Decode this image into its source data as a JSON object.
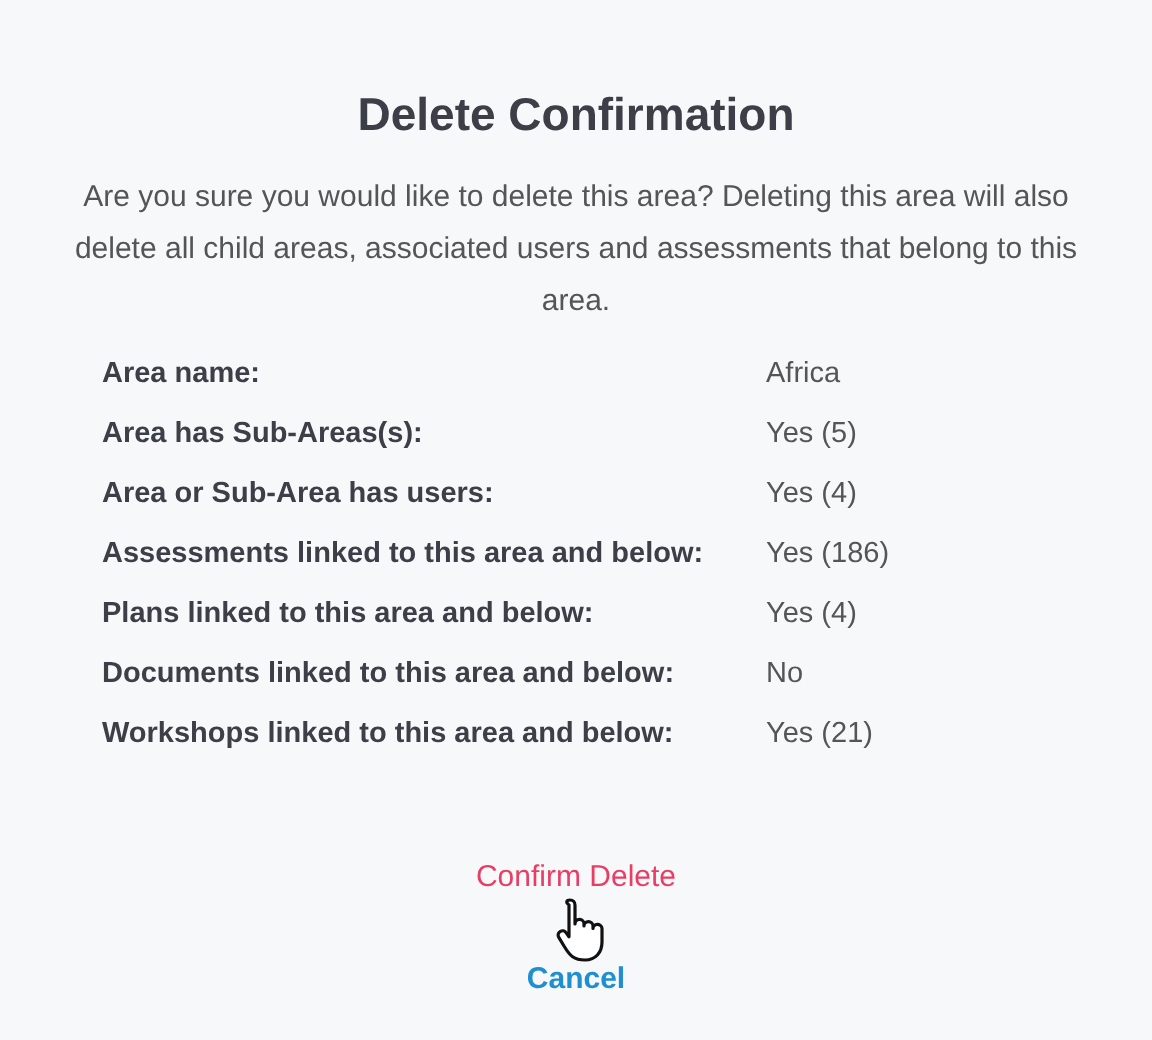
{
  "dialog": {
    "title": "Delete Confirmation",
    "message": "Are you sure you would like to delete this area? Deleting this area will also delete all child areas, associated users and assessments that belong to this area.",
    "details": [
      {
        "label": "Area name:",
        "value": "Africa"
      },
      {
        "label": "Area has Sub-Areas(s):",
        "value": "Yes (5)"
      },
      {
        "label": "Area or Sub-Area has users:",
        "value": "Yes (4)"
      },
      {
        "label": "Assessments linked to this area and below:",
        "value": "Yes (186)"
      },
      {
        "label": "Plans linked to this area and below:",
        "value": "Yes (4)"
      },
      {
        "label": "Documents linked to this area and below:",
        "value": "No"
      },
      {
        "label": "Workshops linked to this area and below:",
        "value": "Yes (21)"
      }
    ],
    "actions": [
      {
        "label": "Confirm Delete",
        "kind": "danger"
      },
      {
        "label": "Cancel",
        "kind": "primary"
      }
    ]
  }
}
